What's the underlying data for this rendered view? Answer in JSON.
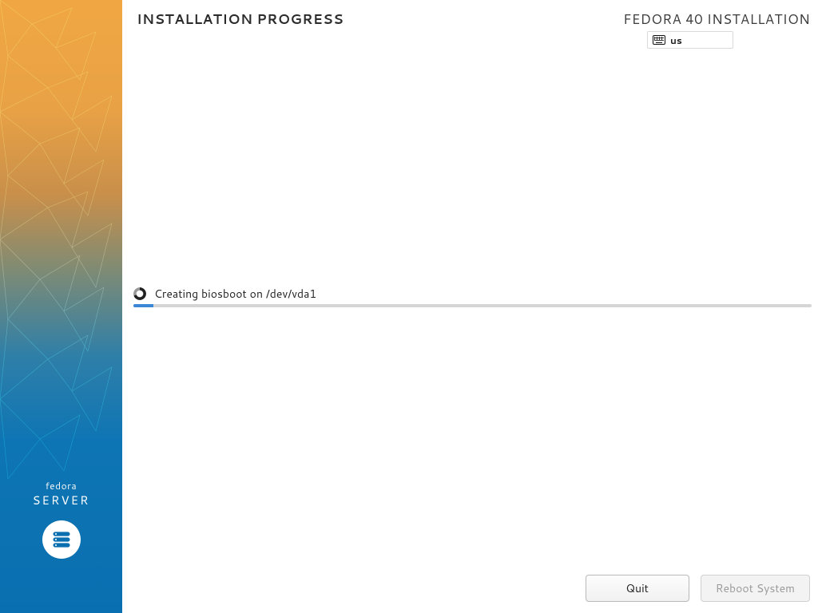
{
  "header": {
    "title": "INSTALLATION PROGRESS",
    "product": "FEDORA 40 INSTALLATION",
    "keyboard_layout": "us"
  },
  "sidebar": {
    "brand_line1": "fedora",
    "brand_line2": "SERVER",
    "accent_top": "#f0a743",
    "accent_bottom": "#0a6fb0"
  },
  "progress": {
    "status_text": "Creating biosboot on /dev/vda1",
    "percent": 3
  },
  "footer": {
    "quit_label": "Quit",
    "reboot_label": "Reboot System",
    "reboot_enabled": false
  }
}
